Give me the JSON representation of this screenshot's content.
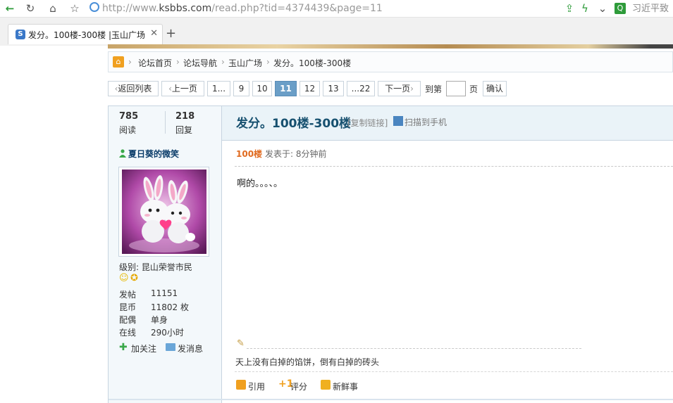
{
  "browser": {
    "url_prefix": "http://www.",
    "url_domain": "ksbbs.com",
    "url_path": "/read.php?tid=4374439&page=11",
    "search_hint": "习近平致",
    "tab_title": "发分。100楼-300楼 |玉山广场",
    "tab_favicon": "S"
  },
  "breadcrumb": [
    "论坛首页",
    "论坛导航",
    "玉山广场",
    "发分。100楼-300楼"
  ],
  "pagination": {
    "back": "返回列表",
    "prev": "上一页",
    "first": "1...",
    "pages": [
      "9",
      "10",
      "11",
      "12",
      "13"
    ],
    "last": "...22",
    "next": "下一页",
    "goto": "到第",
    "page_unit": "页",
    "confirm": "确认",
    "current": "11"
  },
  "thread": {
    "views": "785",
    "views_label": "阅读",
    "replies": "218",
    "replies_label": "回复",
    "title": "发分。100楼-300楼",
    "copy_link": "[复制链接]",
    "scan": "扫描到手机"
  },
  "author": {
    "name": "夏日葵的微笑",
    "level": "级别: 昆山荣誉市民",
    "stats": [
      {
        "label": "发帖",
        "value": "11151"
      },
      {
        "label": "昆币",
        "value": "11802 枚"
      },
      {
        "label": "配偶",
        "value": "单身"
      },
      {
        "label": "在线",
        "value": "290小时"
      }
    ],
    "follow": "加关注",
    "message": "发消息"
  },
  "post": {
    "floor": "100楼",
    "posted_at": "发表于: 8分钟前",
    "body": "啊的。。。、。",
    "signature": "天上没有白掉的馅饼，倒有白掉的砖头",
    "actions": [
      "引用",
      "评分",
      "新鲜事"
    ]
  },
  "colors": {
    "accent": "#6a9ec7",
    "title": "#16506f",
    "floor": "#e06a1f"
  }
}
